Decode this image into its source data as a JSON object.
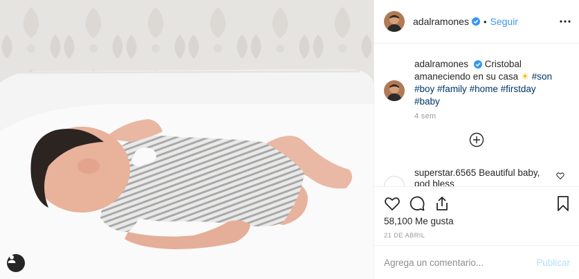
{
  "colors": {
    "accent": "#3897f0",
    "hashtag": "#003569",
    "text": "#262626",
    "muted": "#999999",
    "publish_disabled": "#b2dffc",
    "border": "#efefef"
  },
  "photo": {
    "user_tag_icon": "user-circle-icon"
  },
  "header": {
    "username": "adalramones",
    "separator": "•",
    "follow_label": "Seguir",
    "more_icon": "more-horizontal-icon"
  },
  "caption": {
    "username": "adalramones",
    "text": "Cristobal amaneciendo en su casa",
    "emoji": "☀",
    "hashtags": [
      "#son",
      "#boy",
      "#family",
      "#home",
      "#firstday",
      "#baby"
    ],
    "time_ago": "4 sem"
  },
  "load_more_icon": "plus-circle-icon",
  "comment": {
    "username": "superstar.6565",
    "text": "Beautiful baby,",
    "text_line2": "god bless"
  },
  "actions": {
    "like_icon": "heart-icon",
    "comment_icon": "comment-icon",
    "share_icon": "share-icon",
    "save_icon": "bookmark-icon",
    "likes": "58,100 Me gusta",
    "date": "21 DE ABRIL"
  },
  "add_comment": {
    "placeholder": "Agrega un comentario...",
    "publish_label": "Publicar"
  }
}
